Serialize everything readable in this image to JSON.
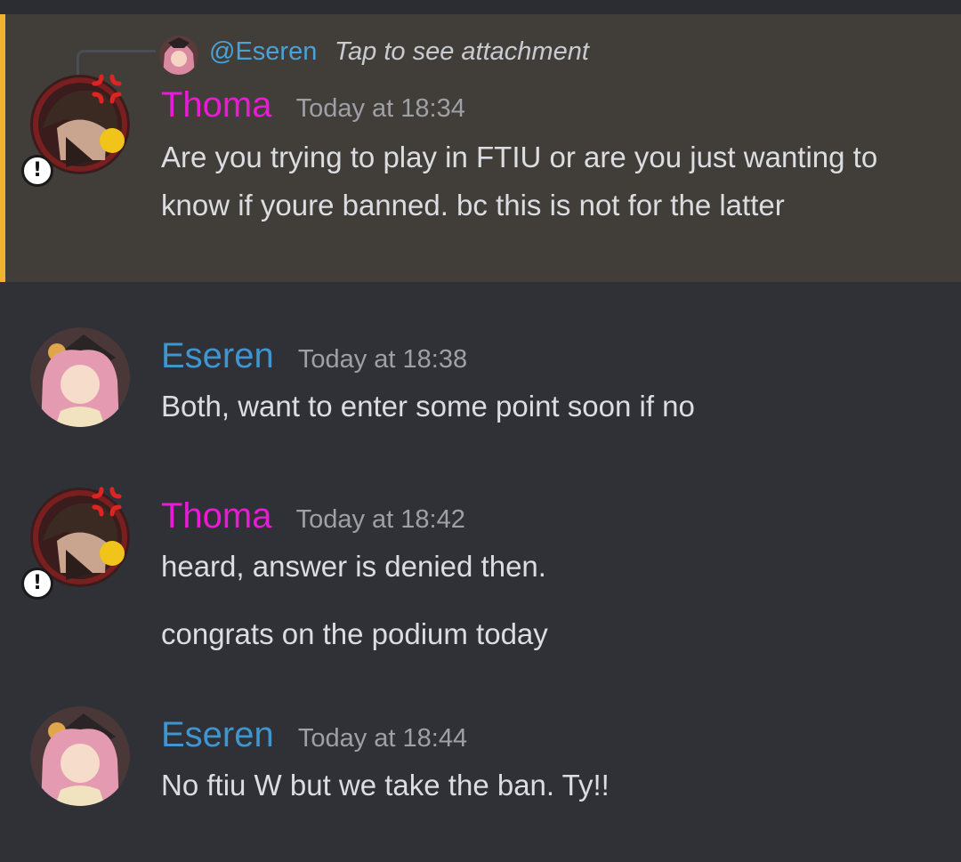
{
  "reply": {
    "mention": "@Eseren",
    "text": "Tap to see attachment",
    "avatar_icon": "eseren-avatar"
  },
  "messages": [
    {
      "author": "Thoma",
      "timestamp": "Today at 18:34",
      "lines": [
        "Are you trying to play in FTIU or are you just wanting to know if youre banned. bc this is not for the latter"
      ],
      "author_color": "#e81bd6",
      "highlighted": true
    },
    {
      "author": "Eseren",
      "timestamp": "Today at 18:38",
      "lines": [
        "Both, want to enter some point soon if no"
      ],
      "author_color": "#3f95cf"
    },
    {
      "author": "Thoma",
      "timestamp": "Today at 18:42",
      "lines": [
        "heard, answer is denied then.",
        "congrats on the podium today"
      ],
      "author_color": "#e81bd6"
    },
    {
      "author": "Eseren",
      "timestamp": "Today at 18:44",
      "lines": [
        "No ftiu W but we take the ban. Ty!!"
      ],
      "author_color": "#3f95cf"
    }
  ],
  "badge": {
    "text": "!"
  },
  "colors": {
    "background": "#2f3137",
    "highlight_bg": "#413e3a",
    "highlight_bar": "#f0b232",
    "mention": "#4aa1d6"
  }
}
